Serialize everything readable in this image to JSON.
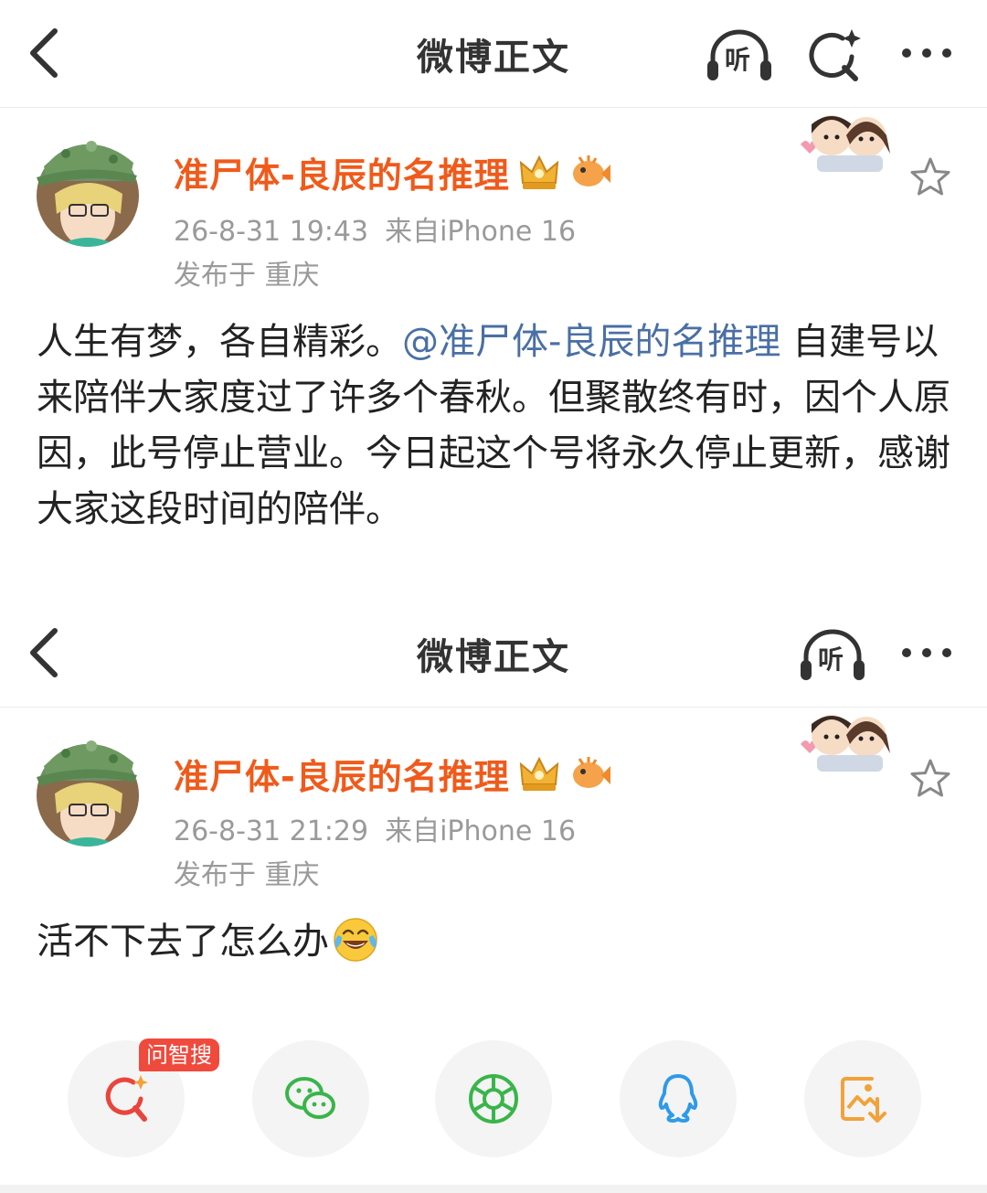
{
  "colors": {
    "username": "#f05a1a",
    "mention": "#4a6fa5",
    "meta": "#9a9a9a",
    "ai_tag": "#f04a3c"
  },
  "screens": [
    {
      "nav": {
        "title": "微博正文",
        "listen_label": "听",
        "icons": [
          "back-icon",
          "listen-icon",
          "ai-search-icon",
          "more-icon"
        ]
      },
      "post": {
        "username": "准尸体-良辰的名推理",
        "time": "26-8-31 19:43",
        "source": "来自iPhone 16",
        "location": "发布于 重庆",
        "text_before": "人生有梦，各自精彩。",
        "mention": "@准尸体-良辰的名推理",
        "text_after": " 自建号以来陪伴大家度过了许多个春秋。但聚散终有时，因个人原因，此号停止营业。今日起这个号将永久停止更新，感谢大家这段时间的陪伴。"
      }
    },
    {
      "nav": {
        "title": "微博正文",
        "listen_label": "听",
        "icons": [
          "back-icon",
          "listen-icon",
          "more-icon"
        ]
      },
      "post": {
        "username": "准尸体-良辰的名推理",
        "time": "26-8-31 21:29",
        "source": "来自iPhone 16",
        "location": "发布于 重庆",
        "text": "活不下去了怎么办",
        "emoji": "laughing-crying-emoji"
      }
    }
  ],
  "share_bar": {
    "ai_tag": "问智搜",
    "buttons": [
      "ai-search-icon",
      "wechat-icon",
      "moments-icon",
      "qq-icon",
      "save-image-icon"
    ]
  }
}
